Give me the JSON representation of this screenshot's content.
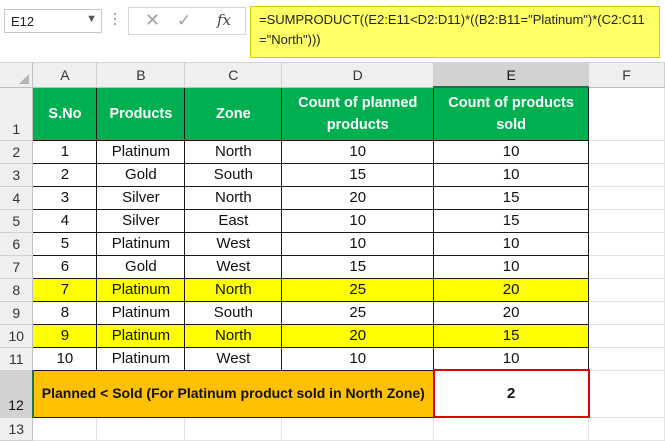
{
  "formula_bar": {
    "name_box": "E12",
    "formula": "=SUMPRODUCT((E2:E11<D2:D11)*((B2:B11=\"Platinum\")*(C2:C11=\"North\")))"
  },
  "columns": [
    "A",
    "B",
    "C",
    "D",
    "E",
    "F"
  ],
  "rows": [
    "1",
    "2",
    "3",
    "4",
    "5",
    "6",
    "7",
    "8",
    "9",
    "10",
    "11",
    "12",
    "13"
  ],
  "header": {
    "a": "S.No",
    "b": "Products",
    "c": "Zone",
    "d": "Count of planned products",
    "e": "Count of products sold"
  },
  "data": [
    {
      "sno": "1",
      "product": "Platinum",
      "zone": "North",
      "planned": "10",
      "sold": "10",
      "highlight": false
    },
    {
      "sno": "2",
      "product": "Gold",
      "zone": "South",
      "planned": "15",
      "sold": "10",
      "highlight": false
    },
    {
      "sno": "3",
      "product": "Silver",
      "zone": "North",
      "planned": "20",
      "sold": "15",
      "highlight": false
    },
    {
      "sno": "4",
      "product": "Silver",
      "zone": "East",
      "planned": "10",
      "sold": "15",
      "highlight": false
    },
    {
      "sno": "5",
      "product": "Platinum",
      "zone": "West",
      "planned": "10",
      "sold": "10",
      "highlight": false
    },
    {
      "sno": "6",
      "product": "Gold",
      "zone": "West",
      "planned": "15",
      "sold": "10",
      "highlight": false
    },
    {
      "sno": "7",
      "product": "Platinum",
      "zone": "North",
      "planned": "25",
      "sold": "20",
      "highlight": true
    },
    {
      "sno": "8",
      "product": "Platinum",
      "zone": "South",
      "planned": "25",
      "sold": "20",
      "highlight": false
    },
    {
      "sno": "9",
      "product": "Platinum",
      "zone": "North",
      "planned": "20",
      "sold": "15",
      "highlight": true
    },
    {
      "sno": "10",
      "product": "Platinum",
      "zone": "West",
      "planned": "10",
      "sold": "10",
      "highlight": false
    }
  ],
  "summary": {
    "label": "Planned < Sold (For Platinum product sold in North Zone)",
    "result": "2"
  },
  "colors": {
    "header_bg": "#00b050",
    "highlight_bg": "#ffff00",
    "summary_bg": "#ffc000",
    "formula_bg": "#ffff66",
    "selected_border": "#e00000"
  }
}
